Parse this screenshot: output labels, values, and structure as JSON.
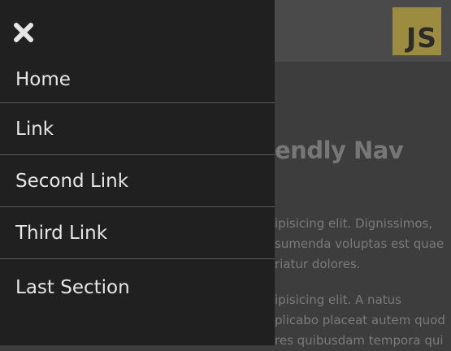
{
  "header": {
    "logo_text": "JS",
    "logo_color": "#9c8c3f"
  },
  "main": {
    "title": "endly Nav",
    "paragraphs": [
      [
        "ipisicing elit. Dignissimos,",
        "sumenda voluptas est quae",
        "riatur dolores."
      ],
      [
        "ipisicing elit. A natus",
        "plicabo placeat autem quod",
        "res quibusdam tempora qui"
      ]
    ]
  },
  "sidenav": {
    "close_icon": "close-icon",
    "items": [
      {
        "label": "Home"
      },
      {
        "label": "Link"
      },
      {
        "label": "Second Link"
      },
      {
        "label": "Third Link"
      },
      {
        "label": "Last Section"
      }
    ]
  }
}
